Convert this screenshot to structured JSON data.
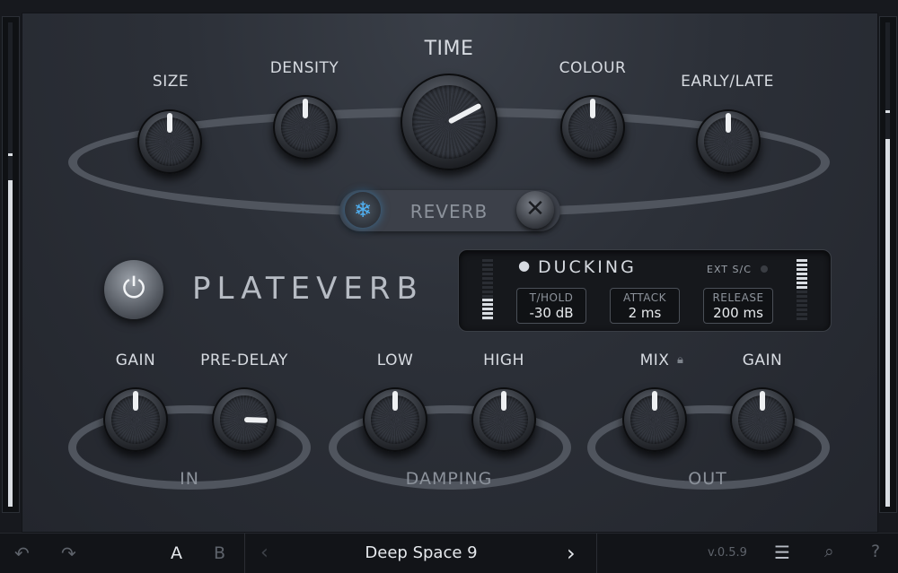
{
  "plugin": {
    "name": "PLATEVERB",
    "reverb_section": "REVERB",
    "knobs_top": [
      "SIZE",
      "DENSITY",
      "TIME",
      "COLOUR",
      "EARLY/LATE"
    ],
    "in_section": {
      "label": "IN",
      "knobs": [
        "GAIN",
        "PRE-DELAY"
      ]
    },
    "damping_section": {
      "label": "DAMPING",
      "knobs": [
        "LOW",
        "HIGH"
      ]
    },
    "out_section": {
      "label": "OUT",
      "knobs": [
        "MIX",
        "GAIN"
      ]
    },
    "freeze_icon": "snowflake-icon",
    "clear_icon": "close-icon",
    "power_icon": "power-icon"
  },
  "ducking": {
    "title": "DUCKING",
    "ext_sc": "EXT S/C",
    "params": [
      {
        "title": "T/HOLD",
        "value": "-30 dB"
      },
      {
        "title": "ATTACK",
        "value": "2 ms"
      },
      {
        "title": "RELEASE",
        "value": "200 ms"
      }
    ]
  },
  "bottom_bar": {
    "undo_icon": "undo-icon",
    "redo_icon": "redo-icon",
    "a_label": "A",
    "b_label": "B",
    "preset_name": "Deep Space 9",
    "version": "v.0.5.9",
    "icons": [
      "sliders-icon",
      "search-icon",
      "help-icon"
    ]
  },
  "colors": {
    "accent": "#3aa0e8",
    "panel": "#2c3038",
    "text": "#d7dbe1"
  }
}
